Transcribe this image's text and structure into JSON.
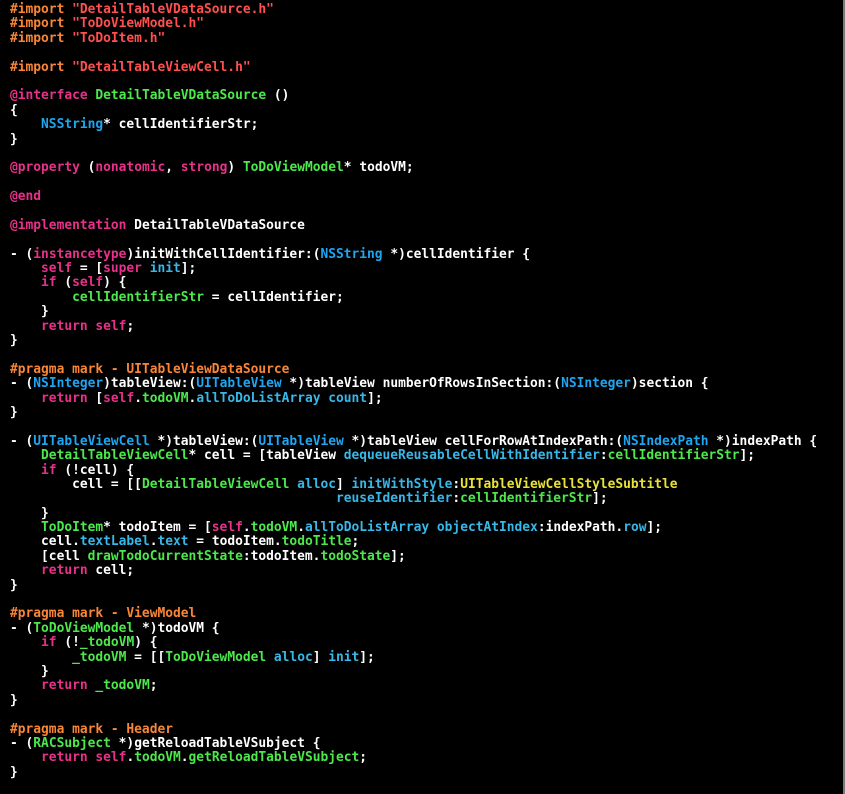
{
  "editor": {
    "language": "Objective-C",
    "theme_colors": {
      "background": "#000000",
      "plain": "#ffffff",
      "directive": "#f98637",
      "string": "#ff4f4f",
      "keyword": "#e7318a",
      "class": "#4ce84c",
      "type": "#1ea6f2",
      "method": "#38b8e8",
      "member": "#4ce84c",
      "constant": "#e8e23a"
    },
    "lines": [
      [
        [
          "directive",
          "#import "
        ],
        [
          "string",
          "\"DetailTableVDataSource.h\""
        ]
      ],
      [
        [
          "directive",
          "#import "
        ],
        [
          "string",
          "\"ToDoViewModel.h\""
        ]
      ],
      [
        [
          "directive",
          "#import "
        ],
        [
          "string",
          "\"ToDoItem.h\""
        ]
      ],
      [],
      [
        [
          "directive",
          "#import "
        ],
        [
          "string",
          "\"DetailTableViewCell.h\""
        ]
      ],
      [],
      [
        [
          "keyword",
          "@interface"
        ],
        [
          "plain",
          " "
        ],
        [
          "class",
          "DetailTableVDataSource"
        ],
        [
          "plain",
          " ()"
        ]
      ],
      [
        [
          "plain",
          "{"
        ]
      ],
      [
        [
          "plain",
          "    "
        ],
        [
          "type",
          "NSString"
        ],
        [
          "plain",
          "* cellIdentifierStr;"
        ]
      ],
      [
        [
          "plain",
          "}"
        ]
      ],
      [],
      [
        [
          "keyword",
          "@property"
        ],
        [
          "plain",
          " ("
        ],
        [
          "keyword",
          "nonatomic"
        ],
        [
          "plain",
          ", "
        ],
        [
          "keyword",
          "strong"
        ],
        [
          "plain",
          ") "
        ],
        [
          "class",
          "ToDoViewModel"
        ],
        [
          "plain",
          "* todoVM;"
        ]
      ],
      [],
      [
        [
          "keyword",
          "@end"
        ]
      ],
      [],
      [
        [
          "keyword",
          "@implementation"
        ],
        [
          "plain",
          " DetailTableVDataSource"
        ]
      ],
      [],
      [
        [
          "plain",
          "- ("
        ],
        [
          "keyword",
          "instancetype"
        ],
        [
          "plain",
          ")initWithCellIdentifier:("
        ],
        [
          "type",
          "NSString"
        ],
        [
          "plain",
          " *)cellIdentifier {"
        ]
      ],
      [
        [
          "plain",
          "    "
        ],
        [
          "keyword",
          "self"
        ],
        [
          "plain",
          " = ["
        ],
        [
          "keyword",
          "super"
        ],
        [
          "plain",
          " "
        ],
        [
          "method",
          "init"
        ],
        [
          "plain",
          "];"
        ]
      ],
      [
        [
          "plain",
          "    "
        ],
        [
          "keyword",
          "if"
        ],
        [
          "plain",
          " ("
        ],
        [
          "keyword",
          "self"
        ],
        [
          "plain",
          ") {"
        ]
      ],
      [
        [
          "plain",
          "        "
        ],
        [
          "member",
          "cellIdentifierStr"
        ],
        [
          "plain",
          " = cellIdentifier;"
        ]
      ],
      [
        [
          "plain",
          "    }"
        ]
      ],
      [
        [
          "plain",
          "    "
        ],
        [
          "keyword",
          "return"
        ],
        [
          "plain",
          " "
        ],
        [
          "keyword",
          "self"
        ],
        [
          "plain",
          ";"
        ]
      ],
      [
        [
          "plain",
          "}"
        ]
      ],
      [],
      [
        [
          "pragma",
          "#pragma mark - UITableViewDataSource"
        ]
      ],
      [
        [
          "plain",
          "- ("
        ],
        [
          "type",
          "NSInteger"
        ],
        [
          "plain",
          ")tableView:("
        ],
        [
          "type",
          "UITableView"
        ],
        [
          "plain",
          " *)tableView numberOfRowsInSection:("
        ],
        [
          "type",
          "NSInteger"
        ],
        [
          "plain",
          ")section {"
        ]
      ],
      [
        [
          "plain",
          "    "
        ],
        [
          "keyword",
          "return"
        ],
        [
          "plain",
          " ["
        ],
        [
          "keyword",
          "self"
        ],
        [
          "plain",
          "."
        ],
        [
          "member",
          "todoVM"
        ],
        [
          "plain",
          "."
        ],
        [
          "method",
          "allToDoListArray"
        ],
        [
          "plain",
          " "
        ],
        [
          "method",
          "count"
        ],
        [
          "plain",
          "];"
        ]
      ],
      [
        [
          "plain",
          "}"
        ]
      ],
      [],
      [
        [
          "plain",
          "- ("
        ],
        [
          "type",
          "UITableViewCell"
        ],
        [
          "plain",
          " *)tableView:("
        ],
        [
          "type",
          "UITableView"
        ],
        [
          "plain",
          " *)tableView cellForRowAtIndexPath:("
        ],
        [
          "type",
          "NSIndexPath"
        ],
        [
          "plain",
          " *)indexPath {"
        ]
      ],
      [
        [
          "plain",
          "    "
        ],
        [
          "class",
          "DetailTableViewCell"
        ],
        [
          "plain",
          "* cell = [tableView "
        ],
        [
          "method",
          "dequeueReusableCellWithIdentifier"
        ],
        [
          "plain",
          ":"
        ],
        [
          "member",
          "cellIdentifierStr"
        ],
        [
          "plain",
          "];"
        ]
      ],
      [
        [
          "plain",
          "    "
        ],
        [
          "keyword",
          "if"
        ],
        [
          "plain",
          " (!cell) {"
        ]
      ],
      [
        [
          "plain",
          "        cell = [["
        ],
        [
          "class",
          "DetailTableViewCell"
        ],
        [
          "plain",
          " "
        ],
        [
          "method",
          "alloc"
        ],
        [
          "plain",
          "] "
        ],
        [
          "method",
          "initWithStyle"
        ],
        [
          "plain",
          ":"
        ],
        [
          "constant",
          "UITableViewCellStyleSubtitle"
        ]
      ],
      [
        [
          "plain",
          "                                          "
        ],
        [
          "method",
          "reuseIdentifier"
        ],
        [
          "plain",
          ":"
        ],
        [
          "member",
          "cellIdentifierStr"
        ],
        [
          "plain",
          "];"
        ]
      ],
      [
        [
          "plain",
          "    }"
        ]
      ],
      [
        [
          "plain",
          "    "
        ],
        [
          "class",
          "ToDoItem"
        ],
        [
          "plain",
          "* todoItem = ["
        ],
        [
          "keyword",
          "self"
        ],
        [
          "plain",
          "."
        ],
        [
          "member",
          "todoVM"
        ],
        [
          "plain",
          "."
        ],
        [
          "method",
          "allToDoListArray"
        ],
        [
          "plain",
          " "
        ],
        [
          "method",
          "objectAtIndex"
        ],
        [
          "plain",
          ":indexPath."
        ],
        [
          "method",
          "row"
        ],
        [
          "plain",
          "];"
        ]
      ],
      [
        [
          "plain",
          "    cell."
        ],
        [
          "method",
          "textLabel"
        ],
        [
          "plain",
          "."
        ],
        [
          "method",
          "text"
        ],
        [
          "plain",
          " = todoItem."
        ],
        [
          "member",
          "todoTitle"
        ],
        [
          "plain",
          ";"
        ]
      ],
      [
        [
          "plain",
          "    [cell "
        ],
        [
          "member",
          "drawTodoCurrentState"
        ],
        [
          "plain",
          ":todoItem."
        ],
        [
          "member",
          "todoState"
        ],
        [
          "plain",
          "];"
        ]
      ],
      [
        [
          "plain",
          "    "
        ],
        [
          "keyword",
          "return"
        ],
        [
          "plain",
          " cell;"
        ]
      ],
      [
        [
          "plain",
          "}"
        ]
      ],
      [],
      [
        [
          "pragma",
          "#pragma mark - ViewModel"
        ]
      ],
      [
        [
          "plain",
          "- ("
        ],
        [
          "class",
          "ToDoViewModel"
        ],
        [
          "plain",
          " *)todoVM {"
        ]
      ],
      [
        [
          "plain",
          "    "
        ],
        [
          "keyword",
          "if"
        ],
        [
          "plain",
          " (!"
        ],
        [
          "member",
          "_todoVM"
        ],
        [
          "plain",
          ") {"
        ]
      ],
      [
        [
          "plain",
          "        "
        ],
        [
          "member",
          "_todoVM"
        ],
        [
          "plain",
          " = [["
        ],
        [
          "class",
          "ToDoViewModel"
        ],
        [
          "plain",
          " "
        ],
        [
          "method",
          "alloc"
        ],
        [
          "plain",
          "] "
        ],
        [
          "method",
          "init"
        ],
        [
          "plain",
          "];"
        ]
      ],
      [
        [
          "plain",
          "    }"
        ]
      ],
      [
        [
          "plain",
          "    "
        ],
        [
          "keyword",
          "return"
        ],
        [
          "plain",
          " "
        ],
        [
          "member",
          "_todoVM"
        ],
        [
          "plain",
          ";"
        ]
      ],
      [
        [
          "plain",
          "}"
        ]
      ],
      [],
      [
        [
          "pragma",
          "#pragma mark - Header"
        ]
      ],
      [
        [
          "plain",
          "- ("
        ],
        [
          "class",
          "RACSubject"
        ],
        [
          "plain",
          " *)getReloadTableVSubject {"
        ]
      ],
      [
        [
          "plain",
          "    "
        ],
        [
          "keyword",
          "return"
        ],
        [
          "plain",
          " "
        ],
        [
          "keyword",
          "self"
        ],
        [
          "plain",
          "."
        ],
        [
          "member",
          "todoVM"
        ],
        [
          "plain",
          "."
        ],
        [
          "member",
          "getReloadTableVSubject"
        ],
        [
          "plain",
          ";"
        ]
      ],
      [
        [
          "plain",
          "}"
        ]
      ]
    ]
  }
}
